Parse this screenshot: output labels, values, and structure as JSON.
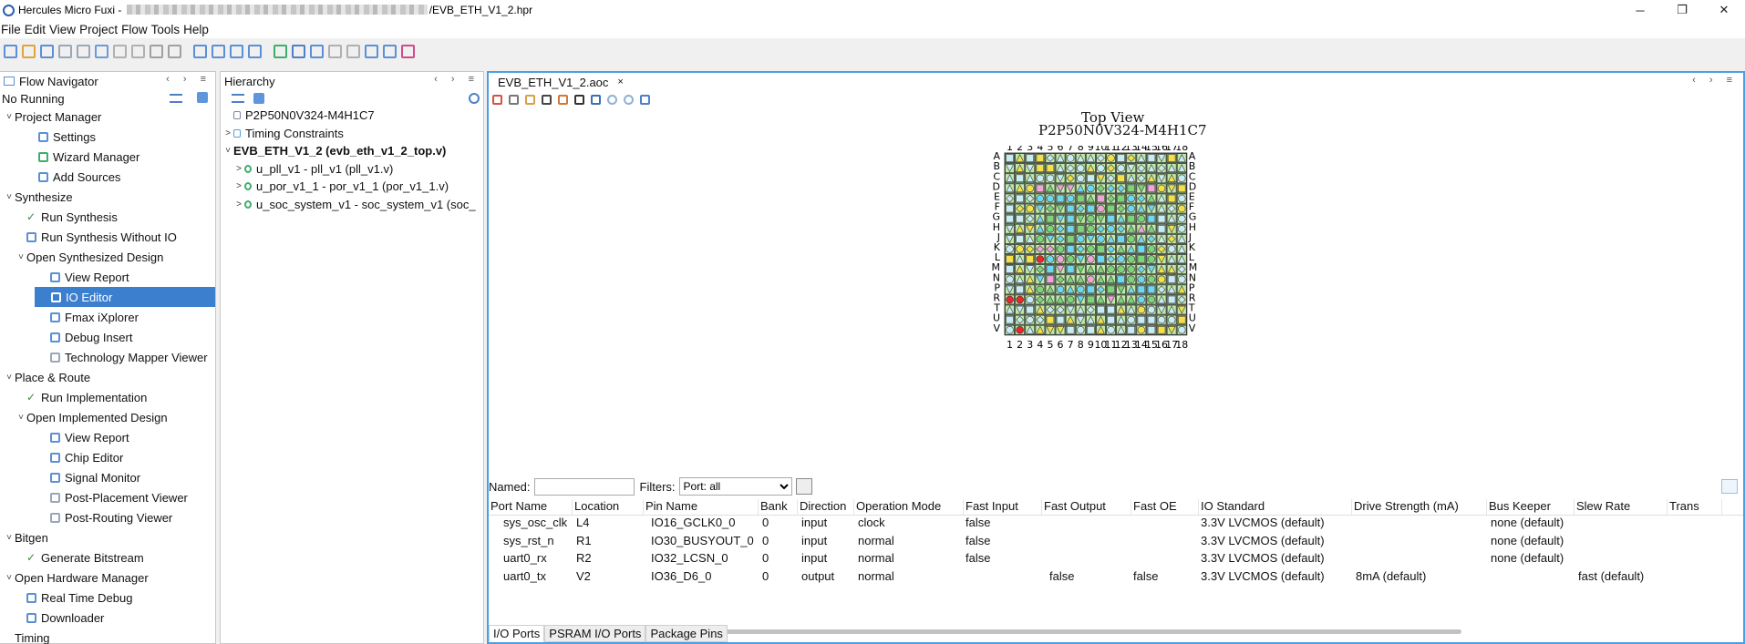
{
  "window": {
    "title_prefix": "Hercules Micro Fuxi - ",
    "title_suffix": "/EVB_ETH_V1_2.hpr",
    "minimize": "─",
    "maximize": "❐",
    "close": "✕"
  },
  "menu": [
    "File",
    "Edit",
    "View",
    "Project",
    "Flow",
    "Tools",
    "Help"
  ],
  "flow_navigator": {
    "title": "Flow Navigator",
    "status": "No Running",
    "rows": [
      {
        "indent": 0,
        "caret": "˅",
        "icon": "",
        "label": "Project Manager",
        "check": false
      },
      {
        "indent": 2,
        "caret": "",
        "icon": "gear",
        "label": "Settings",
        "check": false
      },
      {
        "indent": 2,
        "caret": "",
        "icon": "wizard",
        "label": "Wizard Manager",
        "check": false
      },
      {
        "indent": 2,
        "caret": "",
        "icon": "plus",
        "label": "Add Sources",
        "check": false
      },
      {
        "indent": 0,
        "caret": "˅",
        "icon": "",
        "label": "Synthesize",
        "check": false
      },
      {
        "indent": 1,
        "caret": "",
        "icon": "",
        "label": "Run Synthesis",
        "check": true
      },
      {
        "indent": 1,
        "caret": "",
        "icon": "run",
        "label": "Run Synthesis Without IO",
        "check": false
      },
      {
        "indent": 1,
        "caret": "˅",
        "icon": "",
        "label": "Open Synthesized Design",
        "check": false
      },
      {
        "indent": 3,
        "caret": "",
        "icon": "report",
        "label": "View Report",
        "check": false
      },
      {
        "indent": 3,
        "caret": "",
        "icon": "io",
        "label": "IO Editor",
        "check": false,
        "selected": true
      },
      {
        "indent": 3,
        "caret": "",
        "icon": "fmax",
        "label": "Fmax iXplorer",
        "check": false
      },
      {
        "indent": 3,
        "caret": "",
        "icon": "debug",
        "label": "Debug Insert",
        "check": false
      },
      {
        "indent": 3,
        "caret": "",
        "icon": "mapper",
        "label": "Technology Mapper Viewer",
        "check": false
      },
      {
        "indent": 0,
        "caret": "˅",
        "icon": "",
        "label": "Place & Route",
        "check": false
      },
      {
        "indent": 1,
        "caret": "",
        "icon": "",
        "label": "Run Implementation",
        "check": true
      },
      {
        "indent": 1,
        "caret": "˅",
        "icon": "",
        "label": "Open Implemented Design",
        "check": false
      },
      {
        "indent": 3,
        "caret": "",
        "icon": "report",
        "label": "View Report",
        "check": false
      },
      {
        "indent": 3,
        "caret": "",
        "icon": "chip",
        "label": "Chip Editor",
        "check": false
      },
      {
        "indent": 3,
        "caret": "",
        "icon": "signal",
        "label": "Signal Monitor",
        "check": false
      },
      {
        "indent": 3,
        "caret": "",
        "icon": "mapper",
        "label": "Post-Placement Viewer",
        "check": false
      },
      {
        "indent": 3,
        "caret": "",
        "icon": "mapper",
        "label": "Post-Routing Viewer",
        "check": false
      },
      {
        "indent": 0,
        "caret": "˅",
        "icon": "",
        "label": "Bitgen",
        "check": false
      },
      {
        "indent": 1,
        "caret": "",
        "icon": "",
        "label": "Generate Bitstream",
        "check": true
      },
      {
        "indent": 0,
        "caret": "˅",
        "icon": "",
        "label": "Open Hardware Manager",
        "check": false
      },
      {
        "indent": 1,
        "caret": "",
        "icon": "debug",
        "label": "Real Time Debug",
        "check": false
      },
      {
        "indent": 1,
        "caret": "",
        "icon": "download",
        "label": "Downloader",
        "check": false
      },
      {
        "indent": 0,
        "caret": "",
        "icon": "",
        "label": "Timing",
        "check": false
      }
    ]
  },
  "hierarchy": {
    "title": "Hierarchy",
    "rows": [
      {
        "indent": 0,
        "caret": "",
        "label": "P2P50N0V324-M4H1C7",
        "bold": false
      },
      {
        "indent": 0,
        "caret": ">",
        "label": "Timing Constraints",
        "bold": false
      },
      {
        "indent": 0,
        "caret": "˅",
        "label": "EVB_ETH_V1_2 (evb_eth_v1_2_top.v)",
        "bold": true
      },
      {
        "indent": 1,
        "caret": ">",
        "label": "u_pll_v1 - pll_v1 (pll_v1.v)",
        "bold": false
      },
      {
        "indent": 1,
        "caret": ">",
        "label": "u_por_v1_1 - por_v1_1 (por_v1_1.v)",
        "bold": false
      },
      {
        "indent": 1,
        "caret": ">",
        "label": "u_soc_system_v1 - soc_system_v1 (soc_",
        "bold": false
      }
    ]
  },
  "editor": {
    "tab_label": "EVB_ETH_V1_2.aoc",
    "tab_close": "×",
    "chip_view_title": "Top View",
    "chip_name": "P2P50N0V324-M4H1C7",
    "cols": [
      "1",
      "2",
      "3",
      "4",
      "5",
      "6",
      "7",
      "8",
      "9",
      "10",
      "11",
      "12",
      "13",
      "14",
      "15",
      "16",
      "17",
      "18"
    ],
    "rows": [
      "A",
      "B",
      "C",
      "D",
      "E",
      "F",
      "G",
      "H",
      "J",
      "K",
      "L",
      "M",
      "N",
      "P",
      "R",
      "T",
      "U",
      "V"
    ],
    "colors": {
      "cyan": "#6fd8f0",
      "green": "#7fd37a",
      "yellow": "#f4e04a",
      "red": "#e8272b",
      "pink": "#f0a6d8",
      "light": "#c9ecf4"
    }
  },
  "filters": {
    "named_label": "Named:",
    "named_value": "",
    "filters_label": "Filters:",
    "filter_value": "Port: all"
  },
  "io_table": {
    "columns": [
      "Port Name",
      "Location",
      "Pin Name",
      "Bank",
      "Direction",
      "Operation Mode",
      "Fast Input",
      "Fast Output",
      "Fast OE",
      "IO Standard",
      "Drive Strength (mA)",
      "Bus Keeper",
      "Slew Rate",
      "Trans"
    ],
    "rows": [
      [
        "sys_osc_clk",
        "L4",
        "IO16_GCLK0_0",
        "0",
        "input",
        "clock",
        "false",
        "",
        "",
        "3.3V LVCMOS (default)",
        "",
        "none (default)",
        "",
        ""
      ],
      [
        "sys_rst_n",
        "R1",
        "IO30_BUSYOUT_0",
        "0",
        "input",
        "normal",
        "false",
        "",
        "",
        "3.3V LVCMOS (default)",
        "",
        "none (default)",
        "",
        ""
      ],
      [
        "uart0_rx",
        "R2",
        "IO32_LCSN_0",
        "0",
        "input",
        "normal",
        "false",
        "",
        "",
        "3.3V LVCMOS (default)",
        "",
        "none (default)",
        "",
        ""
      ],
      [
        "uart0_tx",
        "V2",
        "IO36_D6_0",
        "0",
        "output",
        "normal",
        "",
        "false",
        "false",
        "3.3V LVCMOS (default)",
        "8mA (default)",
        "",
        "fast (default)",
        ""
      ]
    ]
  },
  "bottom_tabs": [
    "I/O Ports",
    "PSRAM I/O Ports",
    "Package Pins"
  ]
}
